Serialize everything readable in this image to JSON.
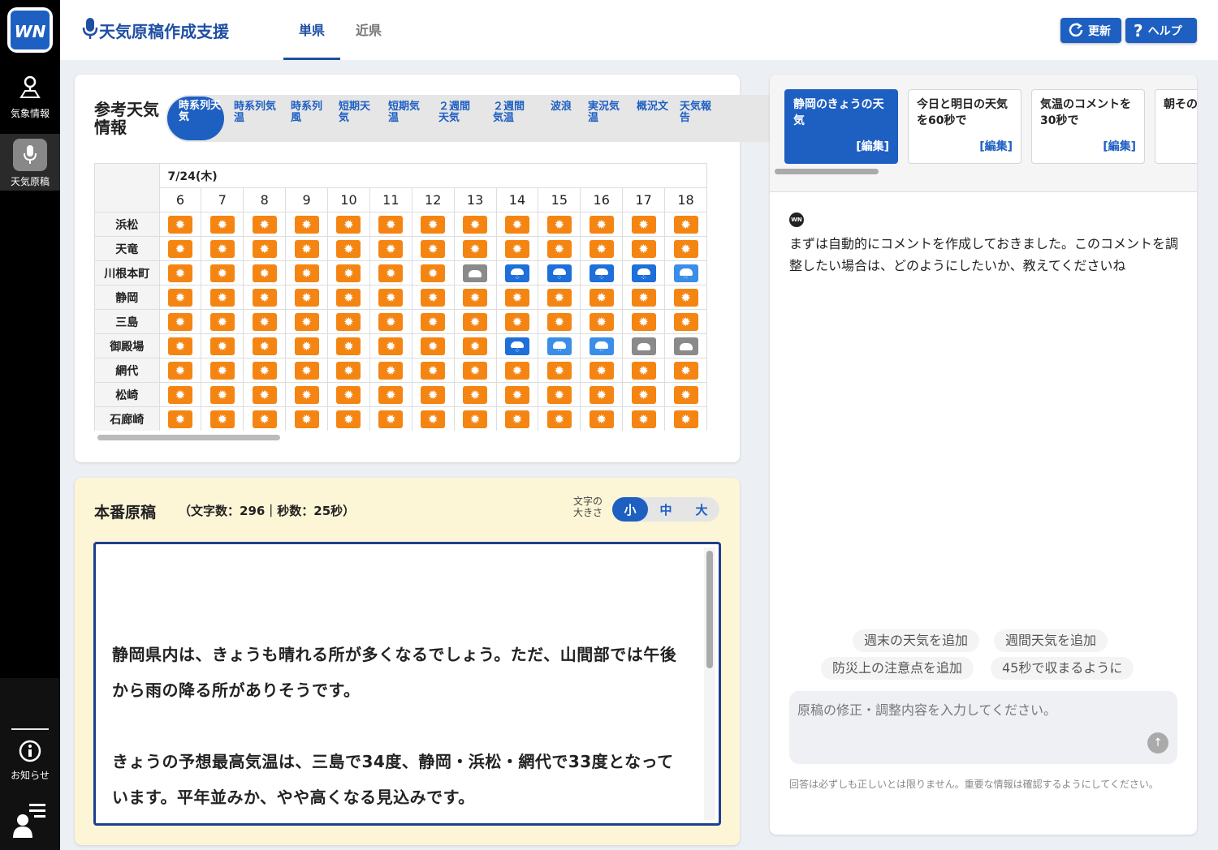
{
  "sidebar": {
    "logo_text": "WN",
    "items": [
      {
        "label": "気象情報",
        "icon": "map-pin-icon"
      },
      {
        "label": "天気原稿",
        "icon": "microphone-icon"
      }
    ],
    "notice_label": "お知らせ",
    "notice_icon": "info-icon",
    "user_icon": "user-menu-icon"
  },
  "header": {
    "title": "天気原稿作成支援",
    "tabs": [
      "単県",
      "近県"
    ],
    "active_tab": "単県",
    "refresh_label": "更新",
    "help_label": "ヘルプ"
  },
  "reference": {
    "title": "参考天気情報",
    "pills": [
      "時系列天気",
      "時系列気温",
      "時系列風",
      "短期天気",
      "短期気温",
      "２週間天気",
      "２週間気温",
      "波浪",
      "実況気温",
      "概況文",
      "天気報告"
    ],
    "active_pill": "時系列天気",
    "grid": {
      "date": "7/24(木)",
      "hours": [
        "6",
        "7",
        "8",
        "9",
        "10",
        "11",
        "12",
        "13",
        "14",
        "15",
        "16",
        "17",
        "18"
      ],
      "rows": [
        {
          "location": "浜松",
          "weather": [
            "sunny",
            "sunny",
            "sunny",
            "sunny",
            "sunny",
            "sunny",
            "sunny",
            "sunny",
            "sunny",
            "sunny",
            "sunny",
            "sunny",
            "sunny"
          ]
        },
        {
          "location": "天竜",
          "weather": [
            "sunny",
            "sunny",
            "sunny",
            "sunny",
            "sunny",
            "sunny",
            "sunny",
            "sunny",
            "sunny",
            "sunny",
            "sunny",
            "sunny",
            "sunny"
          ]
        },
        {
          "location": "川根本町",
          "weather": [
            "sunny",
            "sunny",
            "sunny",
            "sunny",
            "sunny",
            "sunny",
            "sunny",
            "cloudy",
            "rain",
            "rain",
            "rain",
            "rain",
            "lightrain"
          ]
        },
        {
          "location": "静岡",
          "weather": [
            "sunny",
            "sunny",
            "sunny",
            "sunny",
            "sunny",
            "sunny",
            "sunny",
            "sunny",
            "sunny",
            "sunny",
            "sunny",
            "sunny",
            "sunny"
          ]
        },
        {
          "location": "三島",
          "weather": [
            "sunny",
            "sunny",
            "sunny",
            "sunny",
            "sunny",
            "sunny",
            "sunny",
            "sunny",
            "sunny",
            "sunny",
            "sunny",
            "sunny",
            "sunny"
          ]
        },
        {
          "location": "御殿場",
          "weather": [
            "sunny",
            "sunny",
            "sunny",
            "sunny",
            "sunny",
            "sunny",
            "sunny",
            "sunny",
            "rain",
            "lightrain",
            "lightrain",
            "cloudy",
            "cloudy"
          ]
        },
        {
          "location": "網代",
          "weather": [
            "sunny",
            "sunny",
            "sunny",
            "sunny",
            "sunny",
            "sunny",
            "sunny",
            "sunny",
            "sunny",
            "sunny",
            "sunny",
            "sunny",
            "sunny"
          ]
        },
        {
          "location": "松崎",
          "weather": [
            "sunny",
            "sunny",
            "sunny",
            "sunny",
            "sunny",
            "sunny",
            "sunny",
            "sunny",
            "sunny",
            "sunny",
            "sunny",
            "sunny",
            "sunny"
          ]
        },
        {
          "location": "石廊崎",
          "weather": [
            "sunny",
            "sunny",
            "sunny",
            "sunny",
            "sunny",
            "sunny",
            "sunny",
            "sunny",
            "sunny",
            "sunny",
            "sunny",
            "sunny",
            "sunny"
          ]
        }
      ]
    }
  },
  "draft": {
    "title": "本番原稿",
    "stats": "（文字数：296｜秒数：25秒）",
    "font_size_label": "文字の\n大きさ",
    "font_sizes": [
      "小",
      "中",
      "大"
    ],
    "active_font_size": "小",
    "text": "静岡県内は、きょうも晴れる所が多くなるでしょう。ただ、山間部では午後から雨の降る所がありそうです。\n\nきょうの予想最高気温は、三島で34度、静岡・浜松・網代で33度となっています。平年並みか、やや高くなる見込みです。\n\n時間を追って見ていきますと、朝のうちは各地で晴れ間が広がりま"
  },
  "chat": {
    "tabs": [
      {
        "label": "静岡のきょうの天気",
        "edit": "[編集]"
      },
      {
        "label": "今日と明日の天気を60秒で",
        "edit": "[編集]"
      },
      {
        "label": "気温のコメントを30秒で",
        "edit": "[編集]"
      },
      {
        "label": "朝その",
        "edit": ""
      }
    ],
    "active_tab": 0,
    "bot_message": "まずは自動的にコメントを作成しておきました。このコメントを調整したい場合は、どのようにしたいか、教えてくださいね",
    "suggestions": [
      "週末の天気を追加",
      "週間天気を追加",
      "防災上の注意点を追加",
      "45秒で収まるように"
    ],
    "input_placeholder": "原稿の修正・調整内容を入力してください。",
    "disclaimer": "回答は必ずしも正しいとは限りません。重要な情報は確認するようにしてください。"
  },
  "colors": {
    "primary": "#1e5fc2",
    "dark_blue": "#1e3f8f",
    "sunny": "#f58512",
    "rain": "#1e6fd9",
    "cloudy": "#8a8a8a",
    "draft_bg": "#fcf5d6"
  }
}
